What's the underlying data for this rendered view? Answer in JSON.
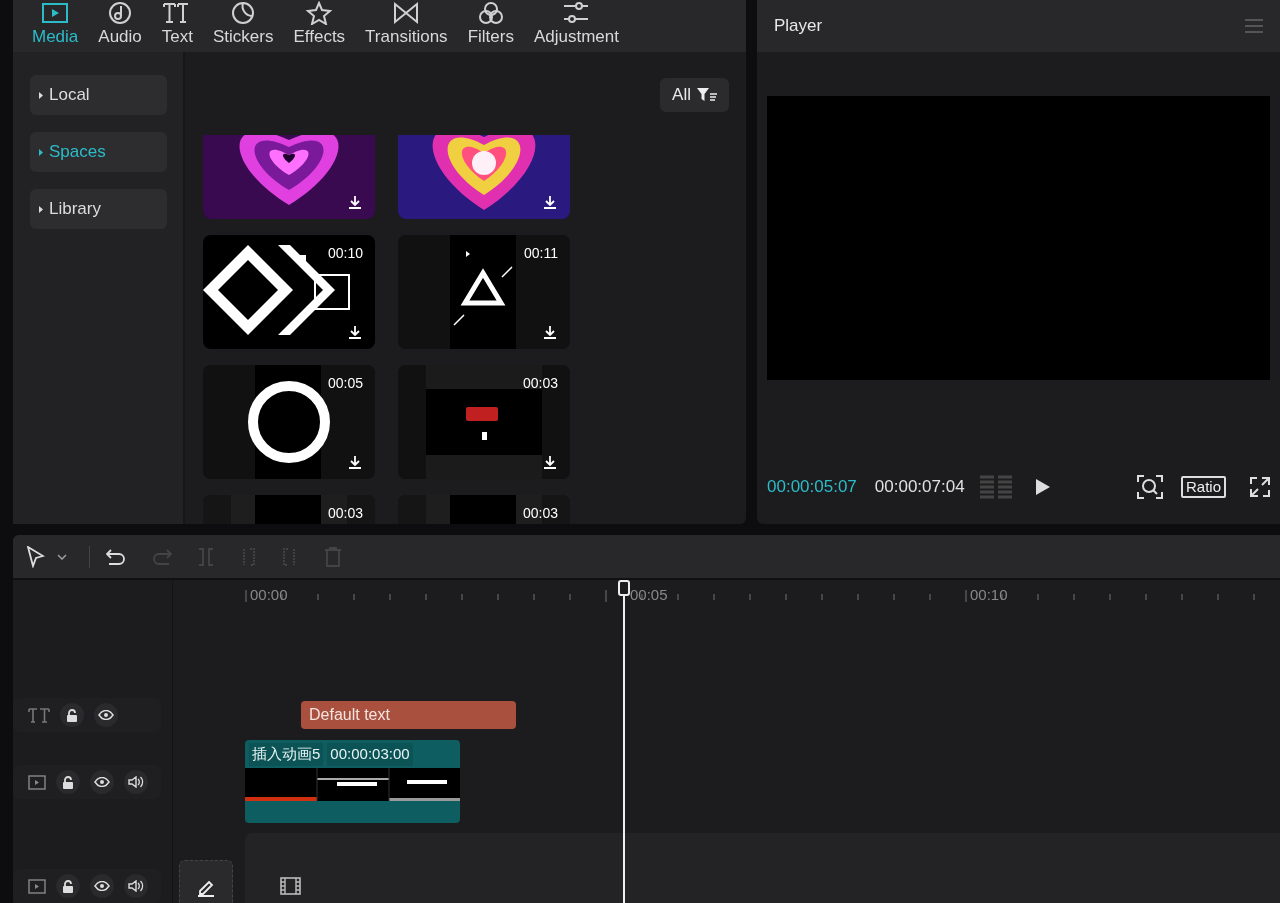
{
  "tabs": [
    {
      "label": "Media",
      "selected": true
    },
    {
      "label": "Audio",
      "selected": false
    },
    {
      "label": "Text",
      "selected": false
    },
    {
      "label": "Stickers",
      "selected": false
    },
    {
      "label": "Effects",
      "selected": false
    },
    {
      "label": "Transitions",
      "selected": false
    },
    {
      "label": "Filters",
      "selected": false
    },
    {
      "label": "Adjustment",
      "selected": false
    }
  ],
  "sidebar": {
    "items": [
      {
        "label": "Local",
        "selected": false
      },
      {
        "label": "Spaces",
        "selected": true
      },
      {
        "label": "Library",
        "selected": false
      }
    ]
  },
  "filter": {
    "label": "All"
  },
  "media": [
    {
      "kind": "picture",
      "download": true
    },
    {
      "kind": "picture",
      "download": true
    },
    {
      "kind": "picture",
      "duration": "00:10",
      "download": true
    },
    {
      "kind": "picture",
      "duration": "00:11",
      "download": true
    },
    {
      "kind": "picture",
      "duration": "00:05",
      "download": true
    },
    {
      "kind": "picture",
      "duration": "00:03",
      "download": true
    },
    {
      "kind": "picture",
      "duration": "00:03",
      "download": false
    },
    {
      "kind": "picture",
      "duration": "00:03",
      "download": false
    }
  ],
  "player": {
    "title": "Player",
    "current_time": "00:00:05:07",
    "total_time": "00:00:07:04",
    "ratio_button": "Ratio"
  },
  "timeline": {
    "ruler": [
      "00:00",
      "00:05",
      "00:10"
    ],
    "tracks": [
      {
        "kind": "text",
        "clips": [
          {
            "label": "Default text"
          }
        ]
      },
      {
        "kind": "video",
        "clips": [
          {
            "label": "插入动画5",
            "duration": "00:00:03:00"
          }
        ]
      },
      {
        "kind": "main"
      }
    ]
  }
}
